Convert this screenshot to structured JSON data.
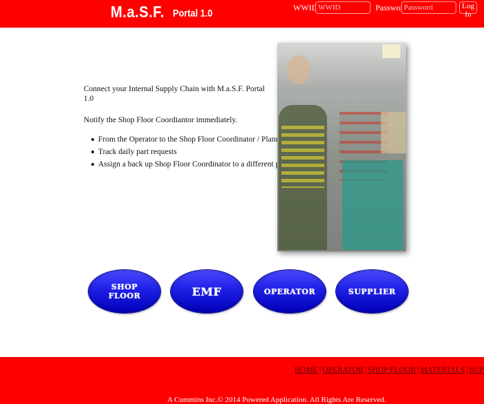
{
  "header": {
    "brand_main": "M.a.S.F.",
    "brand_sub": "Portal 1.0",
    "wwid_label": "WWID:",
    "wwid_placeholder": "WWID",
    "password_label": "Password:",
    "password_placeholder": "Password",
    "login_label": "Log In"
  },
  "intro": {
    "line1": "Connect your Internal Supply Chain with M.a.S.F. Portal 1.0",
    "line2": "Notify the Shop Floor Coordiantor immediately.",
    "bullets": [
      "From the Operator to the Shop Floor Coordinator / Planner.",
      "Track daily part requests",
      "Assign a back up Shop Floor Coordinator to a different production line."
    ]
  },
  "buttons": {
    "shop_floor": "SHOP FLOOR",
    "emf": "EMF",
    "operator": "OPERATOR",
    "supplier": "SUPPLIER"
  },
  "footer": {
    "nav": [
      "HOME",
      "OPERATOR",
      "SHOP FLOOR",
      "MATERIALS",
      "SUPPLIER"
    ],
    "separator": "|",
    "copyright": "A Cummins Inc.© 2014 Powered Application. All Rights Are Reserved."
  },
  "colors": {
    "brand_red": "#ff0000",
    "button_blue": "#1f1fe6",
    "footer_link": "#5a0000"
  }
}
